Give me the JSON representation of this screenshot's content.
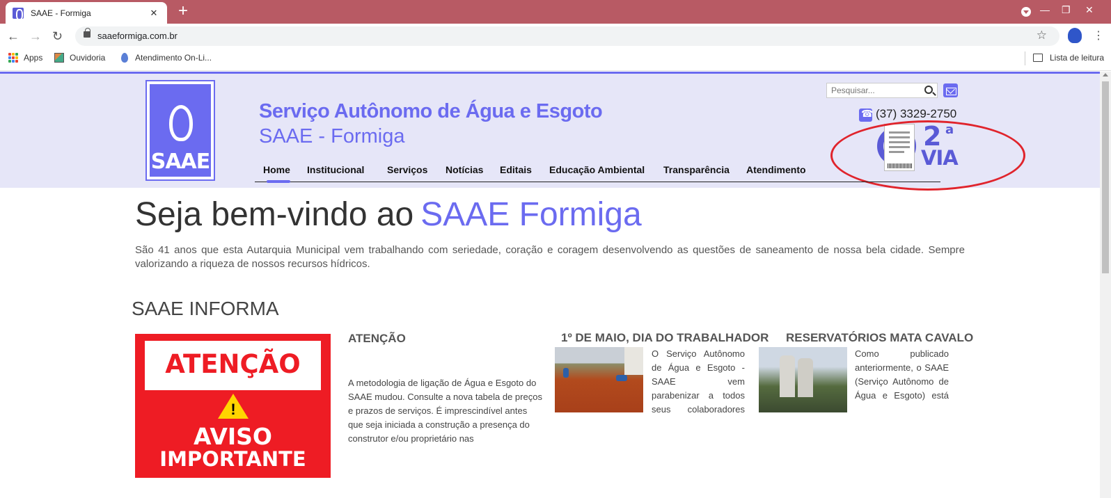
{
  "browser": {
    "tab_title": "SAAE - Formiga",
    "tab_close": "✕",
    "new_tab": "+",
    "url": "saaeformiga.com.br",
    "bookmarks": [
      {
        "label": "Apps",
        "icon": "apps-grid-icon"
      },
      {
        "label": "Ouvidoria",
        "icon": "ouvidoria-icon"
      },
      {
        "label": "Atendimento On-Li...",
        "icon": "water-drop-icon"
      }
    ],
    "reading_list": "Lista de leitura"
  },
  "header": {
    "logo_text": "SAAE",
    "org_name": "Serviço Autônomo de Água e Esgoto",
    "org_short": "SAAE - Formiga",
    "search_placeholder": "Pesquisar...",
    "phone": "(37) 3329-2750",
    "second_copy": {
      "number": "2",
      "superscript": "a",
      "label": "VIA"
    },
    "nav": [
      "Home",
      "Institucional",
      "Serviços",
      "Notícias",
      "Editais",
      "Educação Ambiental",
      "Transparência",
      "Atendimento"
    ],
    "nav_active": "Home"
  },
  "welcome": {
    "prefix": "Seja bem-vindo ao",
    "accent": "SAAE Formiga",
    "intro": "São 41 anos que esta Autarquia Municipal vem trabalhando com seriedade, coração e coragem desenvolvendo as questões de saneamento de nossa bela cidade. Sempre valorizando a riqueza de nossos recursos hídricos."
  },
  "informa": {
    "title": "SAAE INFORMA",
    "featured": {
      "image_title": "ATENÇÃO",
      "image_line1": "AVISO",
      "image_line2": "IMPORTANTE",
      "title": "ATENÇÃO",
      "text": "A metodologia de ligação de Água e Esgoto do SAAE mudou. Consulte a nova tabela de preços e prazos de serviços. É imprescindível antes que seja iniciada a construção a presença do construtor e/ou proprietário nas"
    },
    "news": [
      {
        "title": "1º DE MAIO, DIA DO TRABALHADOR",
        "text": "O Serviço Autônomo de Água e Esgoto - SAAE vem parabenizar a todos seus colaboradores"
      },
      {
        "title": "RESERVATÓRIOS MATA CAVALO",
        "text": "Como publicado anteriormente, o SAAE (Serviço Autônomo de Água e Esgoto) está"
      }
    ]
  },
  "colors": {
    "brand": "#6b6bf0",
    "chrome": "#b85a64",
    "alert_red": "#ee1c24",
    "annotation": "#e0242c"
  }
}
